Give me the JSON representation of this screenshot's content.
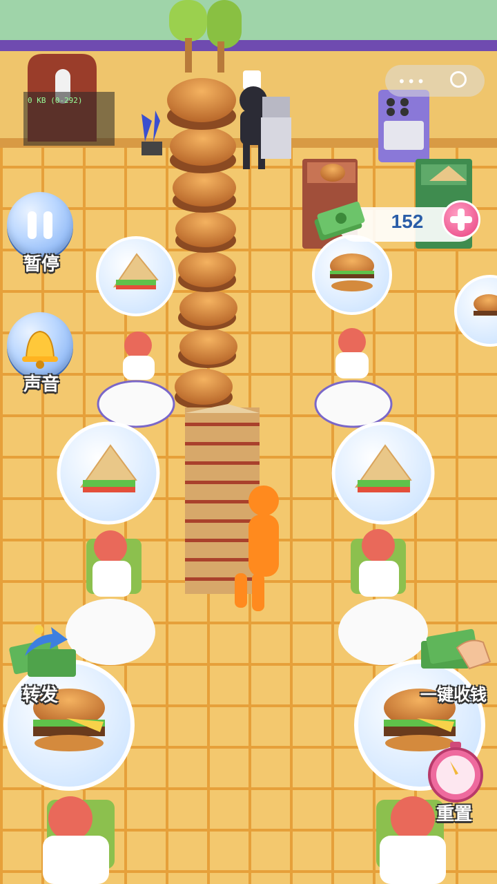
{
  "hud": {
    "debug_text": "0 KB (0-292)",
    "pause_label": "暂停",
    "sound_label": "声音",
    "share_label": "转发",
    "collect_label": "一键收钱",
    "reset_label": "重置",
    "money_value": "152"
  },
  "icons": {
    "pause": "pause-icon",
    "sound": "bell-icon",
    "share": "cash-share-icon",
    "collect": "cash-hand-icon",
    "reset": "stopwatch-icon",
    "money": "cash-stack-icon",
    "add": "plus-icon"
  },
  "colors": {
    "floor": "#f1c56a",
    "grout": "#e8a33a",
    "wall": "#6f4bb0",
    "button": "#8fb8f4",
    "money_text": "#2a5da8",
    "add_button": "#ee4f8f"
  }
}
